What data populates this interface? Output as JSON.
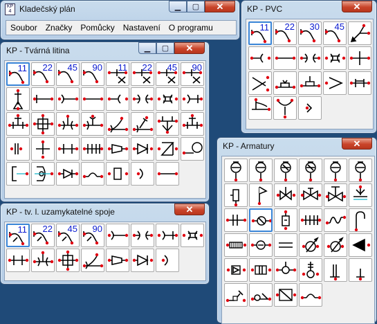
{
  "main": {
    "title": "Kladečský plán",
    "icon_text": "KP",
    "menu": [
      "Soubor",
      "Značky",
      "Pomůcky",
      "Nastavení",
      "O programu"
    ]
  },
  "windows": [
    {
      "id": "litina",
      "title": "KP - Tvárná litina",
      "cells": [
        {
          "icon": "bend-left-icon",
          "num": "11",
          "sel": true
        },
        {
          "icon": "bend-left-icon",
          "num": "22"
        },
        {
          "icon": "bend-left-icon",
          "num": "45"
        },
        {
          "icon": "bend-left-icon",
          "num": "90"
        },
        {
          "icon": "bend-cross-icon",
          "num": "11"
        },
        {
          "icon": "bend-cross-icon",
          "num": "22"
        },
        {
          "icon": "bend-cross-icon",
          "num": "45"
        },
        {
          "icon": "bend-cross-icon",
          "num": "90"
        },
        {
          "icon": "flange-hydrant-icon"
        },
        {
          "icon": "flange-pipe-icon"
        },
        {
          "icon": "socket-pipe-icon"
        },
        {
          "icon": "pipe-icon"
        },
        {
          "icon": "socket-end-icon"
        },
        {
          "icon": "double-socket-icon"
        },
        {
          "icon": "double-flange-icon"
        },
        {
          "icon": "socket-flange-icon"
        },
        {
          "icon": "tee-icon"
        },
        {
          "icon": "cross-icon"
        },
        {
          "icon": "socket-tee-icon"
        },
        {
          "icon": "socket-tee-up-icon"
        },
        {
          "icon": "y-branch-icon"
        },
        {
          "icon": "angled-branch-icon"
        },
        {
          "icon": "drain-tee-icon"
        },
        {
          "icon": "flanged-tee-icon"
        },
        {
          "icon": "blind-flange-icon"
        },
        {
          "icon": "cap-icon"
        },
        {
          "icon": "double-flange-pipe-icon"
        },
        {
          "icon": "triple-flange-icon"
        },
        {
          "icon": "reducer-icon"
        },
        {
          "icon": "reducer-flange-icon"
        },
        {
          "icon": "reducer-z-icon"
        },
        {
          "icon": "loop-icon"
        },
        {
          "icon": "end-cap-icon"
        },
        {
          "icon": "socket-plug-icon"
        },
        {
          "icon": "check-valve-icon"
        },
        {
          "icon": "arc-joint-icon"
        },
        {
          "icon": "box-joint-icon"
        },
        {
          "icon": "half-socket-icon"
        },
        {
          "icon": "plain-pipe-icon"
        }
      ]
    },
    {
      "id": "pvc",
      "title": "KP - PVC",
      "cells": [
        {
          "icon": "pvc-bend-icon",
          "num": "11",
          "sel": true
        },
        {
          "icon": "pvc-bend-icon",
          "num": "22"
        },
        {
          "icon": "pvc-bend-icon",
          "num": "30"
        },
        {
          "icon": "pvc-bend-icon",
          "num": "45"
        },
        {
          "icon": "pvc-y-arrow-icon"
        },
        {
          "icon": "pvc-socket-icon"
        },
        {
          "icon": "pvc-pipe-icon"
        },
        {
          "icon": "pvc-double-socket-icon"
        },
        {
          "icon": "pvc-sleeve-icon"
        },
        {
          "icon": "pvc-flange-icon"
        },
        {
          "icon": "pvc-angled-icon"
        },
        {
          "icon": "pvc-saddle-icon"
        },
        {
          "icon": "pvc-saddle-tee-icon"
        },
        {
          "icon": "pvc-reducer-icon"
        },
        {
          "icon": "pvc-double-pipe-icon"
        },
        {
          "icon": "pvc-tee-icon"
        },
        {
          "icon": "pvc-y-icon"
        },
        {
          "icon": "pvc-mark-icon"
        }
      ]
    },
    {
      "id": "spoje",
      "title": "KP - tv. l. uzamykatelné spoje",
      "cells": [
        {
          "icon": "lock-bend-icon",
          "num": "11",
          "sel": true
        },
        {
          "icon": "lock-bend-icon",
          "num": "22"
        },
        {
          "icon": "lock-bend-icon",
          "num": "45"
        },
        {
          "icon": "lock-bend-icon",
          "num": "90"
        },
        {
          "icon": "lock-socket-pipe-icon"
        },
        {
          "icon": "lock-double-socket-icon"
        },
        {
          "icon": "lock-socket-flange-icon"
        },
        {
          "icon": "lock-double-icon"
        },
        {
          "icon": "lock-pipe-icon"
        },
        {
          "icon": "lock-tee-icon"
        },
        {
          "icon": "lock-cross-icon"
        },
        {
          "icon": "lock-branch-icon"
        },
        {
          "icon": "lock-reducer-icon"
        },
        {
          "icon": "lock-reducer-flange-icon"
        },
        {
          "icon": "lock-half-socket-icon"
        }
      ]
    },
    {
      "id": "armatury",
      "title": "KP - Armatury",
      "cells": [
        {
          "icon": "valve-handwheel-icon"
        },
        {
          "icon": "valve-handwheel-icon"
        },
        {
          "icon": "valve-handwheel-icon"
        },
        {
          "icon": "valve-handwheel-icon"
        },
        {
          "icon": "valve-handwheel-icon"
        },
        {
          "icon": "valve-handwheel-icon"
        },
        {
          "icon": "hydrant-icon"
        },
        {
          "icon": "flag-hydrant-icon"
        },
        {
          "icon": "butterfly-valve-icon"
        },
        {
          "icon": "gate-valve-icon"
        },
        {
          "icon": "gate-valve-stem-icon"
        },
        {
          "icon": "underground-hydrant-icon"
        },
        {
          "icon": "double-plate-icon"
        },
        {
          "icon": "meter-icon",
          "sel": true
        },
        {
          "icon": "filter-icon"
        },
        {
          "icon": "multi-plate-icon"
        },
        {
          "icon": "expansion-icon"
        },
        {
          "icon": "hook-icon"
        },
        {
          "icon": "strainer-icon"
        },
        {
          "icon": "check-box-icon"
        },
        {
          "icon": "gap-icon"
        },
        {
          "icon": "slash-circle-icon"
        },
        {
          "icon": "slash-circle-icon"
        },
        {
          "icon": "cone-icon"
        },
        {
          "icon": "box-valve-icon"
        },
        {
          "icon": "double-box-icon"
        },
        {
          "icon": "pipe-circle-icon"
        },
        {
          "icon": "vent-valve-icon"
        },
        {
          "icon": "probe-icon"
        },
        {
          "icon": "probe-small-icon"
        },
        {
          "icon": "vent-angle-icon"
        },
        {
          "icon": "vent-double-icon"
        },
        {
          "icon": "box-diagonal-icon"
        },
        {
          "icon": "arc-pipe-icon"
        }
      ]
    }
  ]
}
